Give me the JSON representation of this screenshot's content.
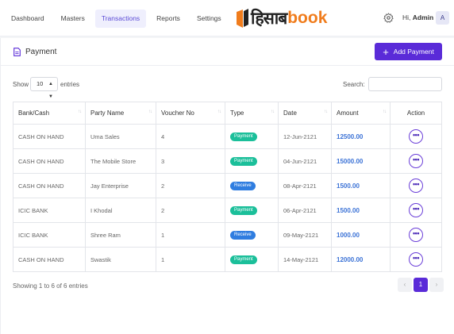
{
  "nav": {
    "items": [
      {
        "label": "Dashboard"
      },
      {
        "label": "Masters"
      },
      {
        "label": "Transactions",
        "active": true
      },
      {
        "label": "Reports"
      },
      {
        "label": "Settings"
      }
    ]
  },
  "brand": {
    "logo_text": "हिसाब",
    "logo_suffix": "book",
    "accent": "#f07c1c"
  },
  "user": {
    "greeting": "Hi,",
    "name": "Admin",
    "initial": "A"
  },
  "page": {
    "title": "Payment",
    "add_button": "Add Payment"
  },
  "table_controls": {
    "show_label": "Show",
    "page_length": "10",
    "entries_label": "entries",
    "search_label": "Search:",
    "search_value": ""
  },
  "table": {
    "columns": [
      "Bank/Cash",
      "Party Name",
      "Voucher No",
      "Type",
      "Date",
      "Amount",
      "Action"
    ],
    "rows": [
      {
        "bank": "CASH ON HAND",
        "party": "Uma Sales",
        "voucher": "4",
        "type": "Payment",
        "date": "12-Jun-2121",
        "amount": "12500.00"
      },
      {
        "bank": "CASH ON HAND",
        "party": "The Mobile Store",
        "voucher": "3",
        "type": "Payment",
        "date": "04-Jun-2121",
        "amount": "15000.00"
      },
      {
        "bank": "CASH ON HAND",
        "party": "Jay Enterprise",
        "voucher": "2",
        "type": "Receive",
        "date": "08-Apr-2121",
        "amount": "1500.00"
      },
      {
        "bank": "ICIC BANK",
        "party": "I Khodal",
        "voucher": "2",
        "type": "Payment",
        "date": "06-Apr-2121",
        "amount": "1500.00"
      },
      {
        "bank": "ICIC BANK",
        "party": "Shree Ram",
        "voucher": "1",
        "type": "Receive",
        "date": "09-May-2121",
        "amount": "1000.00"
      },
      {
        "bank": "CASH ON HAND",
        "party": "Swastik",
        "voucher": "1",
        "type": "Payment",
        "date": "14-May-2121",
        "amount": "12000.00"
      }
    ],
    "action_label": "•••"
  },
  "footer": {
    "info": "Showing 1 to 6 of 6 entries",
    "prev": "‹",
    "current_page": "1",
    "next": "›"
  },
  "colors": {
    "primary": "#5a2bd8",
    "payment_badge": "#1bbf9a",
    "receive_badge": "#2f7de0",
    "amount": "#3b72d6"
  }
}
